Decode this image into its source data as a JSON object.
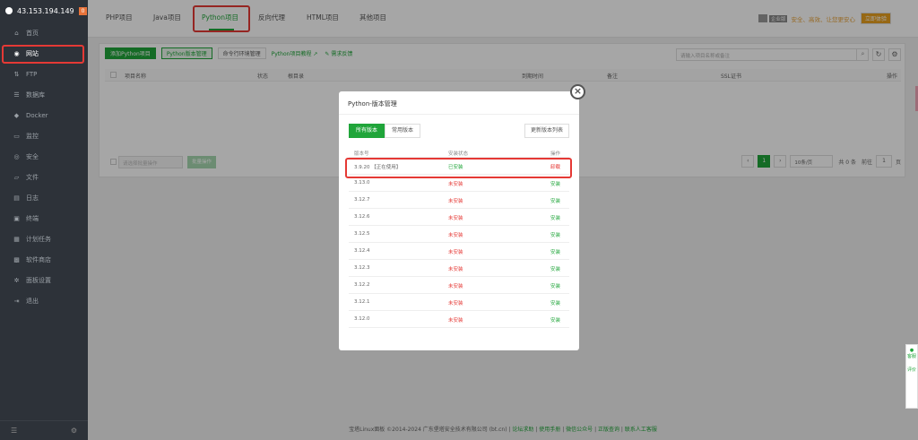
{
  "sidebar": {
    "ip": "43.153.194.149",
    "badge": "0",
    "items": [
      {
        "label": "首页",
        "icon": "home-icon",
        "glyph": "⌂"
      },
      {
        "label": "网站",
        "icon": "globe-icon",
        "glyph": "◉"
      },
      {
        "label": "FTP",
        "icon": "ftp-icon",
        "glyph": "⇅"
      },
      {
        "label": "数据库",
        "icon": "database-icon",
        "glyph": "☰"
      },
      {
        "label": "Docker",
        "icon": "docker-icon",
        "glyph": "◆"
      },
      {
        "label": "监控",
        "icon": "monitor-icon",
        "glyph": "▭"
      },
      {
        "label": "安全",
        "icon": "shield-icon",
        "glyph": "◎"
      },
      {
        "label": "文件",
        "icon": "folder-icon",
        "glyph": "▱"
      },
      {
        "label": "日志",
        "icon": "log-icon",
        "glyph": "▤"
      },
      {
        "label": "终端",
        "icon": "terminal-icon",
        "glyph": "▣"
      },
      {
        "label": "计划任务",
        "icon": "calendar-icon",
        "glyph": "▦"
      },
      {
        "label": "软件商店",
        "icon": "store-icon",
        "glyph": "▩"
      },
      {
        "label": "面板设置",
        "icon": "gear-icon",
        "glyph": "✲"
      },
      {
        "label": "退出",
        "icon": "logout-icon",
        "glyph": "⇥"
      }
    ],
    "active_index": 1
  },
  "tabs": [
    "PHP项目",
    "Java项目",
    "Python项目",
    "反向代理",
    "HTML项目",
    "其他项目"
  ],
  "active_tab": 2,
  "topbar_right": {
    "label": "企业版",
    "text": "安全、高效、让您更安心",
    "button": "立即体验"
  },
  "toolbar": {
    "add_btn": "添加Python项目",
    "version_btn": "Python版本管理",
    "cmd_btn": "命令行环境管理",
    "tutorial_link": "Python项目教程",
    "feedback_link": "需求反馈"
  },
  "search": {
    "placeholder": "请输入项目名称或备注"
  },
  "table_headers": [
    "项目名称",
    "状态",
    "根目录",
    "到期时间",
    "备注",
    "SSL证书",
    "操作"
  ],
  "bulk": {
    "select_placeholder": "请选择批量操作",
    "batch_btn": "批量操作"
  },
  "pager": {
    "current": "1",
    "per_page": "10条/页",
    "total": "共 0 条",
    "goto": "前往",
    "page_input": "1",
    "page_unit": "页"
  },
  "footer": {
    "copyright": "宝塔Linux面板 ©2014-2024 广东堡塔安全技术有限公司 (bt.cn)",
    "links": [
      "论坛求助",
      "使用手册",
      "微信公众号",
      "正版查询",
      "联系人工客服"
    ]
  },
  "modal": {
    "title": "Python-版本管理",
    "tabs": [
      "所有版本",
      "常用版本"
    ],
    "active_tab": 0,
    "refresh_btn": "更新版本列表",
    "headers": [
      "版本号",
      "安装状态",
      "操作"
    ],
    "rows": [
      {
        "version": "3.9.20 【正在使用】",
        "status": "已安装",
        "action": "卸载",
        "installed": true
      },
      {
        "version": "3.13.0",
        "status": "未安装",
        "action": "安装",
        "installed": false
      },
      {
        "version": "3.12.7",
        "status": "未安装",
        "action": "安装",
        "installed": false
      },
      {
        "version": "3.12.6",
        "status": "未安装",
        "action": "安装",
        "installed": false
      },
      {
        "version": "3.12.5",
        "status": "未安装",
        "action": "安装",
        "installed": false
      },
      {
        "version": "3.12.4",
        "status": "未安装",
        "action": "安装",
        "installed": false
      },
      {
        "version": "3.12.3",
        "status": "未安装",
        "action": "安装",
        "installed": false
      },
      {
        "version": "3.12.2",
        "status": "未安装",
        "action": "安装",
        "installed": false
      },
      {
        "version": "3.12.1",
        "status": "未安装",
        "action": "安装",
        "installed": false
      },
      {
        "version": "3.12.0",
        "status": "未安装",
        "action": "安装",
        "installed": false
      }
    ]
  },
  "right_widget": {
    "text1": "客服",
    "text2": "评价"
  },
  "colors": {
    "accent": "#20a53a",
    "danger": "#e53935",
    "sidebar_bg": "#2d3239"
  }
}
